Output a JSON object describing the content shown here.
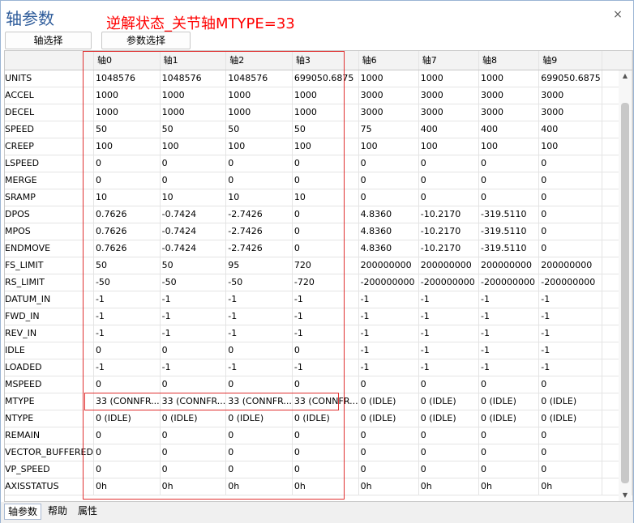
{
  "window": {
    "title": "轴参数",
    "annotation": "逆解状态_关节轴MTYPE=33",
    "close_symbol": "×"
  },
  "toolbar": {
    "axis_select_label": "轴选择",
    "param_select_label": "参数选择"
  },
  "grid": {
    "columns": [
      "",
      "轴0",
      "轴1",
      "轴2",
      "轴3",
      "轴6",
      "轴7",
      "轴8",
      "轴9",
      ""
    ],
    "rows": [
      {
        "name": "UNITS",
        "values": [
          "1048576",
          "1048576",
          "1048576",
          "699050.6875",
          "1000",
          "1000",
          "1000",
          "699050.6875"
        ]
      },
      {
        "name": "ACCEL",
        "values": [
          "1000",
          "1000",
          "1000",
          "1000",
          "3000",
          "3000",
          "3000",
          "3000"
        ]
      },
      {
        "name": "DECEL",
        "values": [
          "1000",
          "1000",
          "1000",
          "1000",
          "3000",
          "3000",
          "3000",
          "3000"
        ]
      },
      {
        "name": "SPEED",
        "values": [
          "50",
          "50",
          "50",
          "50",
          "75",
          "400",
          "400",
          "400"
        ]
      },
      {
        "name": "CREEP",
        "values": [
          "100",
          "100",
          "100",
          "100",
          "100",
          "100",
          "100",
          "100"
        ]
      },
      {
        "name": "LSPEED",
        "values": [
          "0",
          "0",
          "0",
          "0",
          "0",
          "0",
          "0",
          "0"
        ]
      },
      {
        "name": "MERGE",
        "values": [
          "0",
          "0",
          "0",
          "0",
          "0",
          "0",
          "0",
          "0"
        ]
      },
      {
        "name": "SRAMP",
        "values": [
          "10",
          "10",
          "10",
          "10",
          "0",
          "0",
          "0",
          "0"
        ]
      },
      {
        "name": "DPOS",
        "values": [
          "0.7626",
          "-0.7424",
          "-2.7426",
          "0",
          "4.8360",
          "-10.2170",
          "-319.5110",
          "0"
        ]
      },
      {
        "name": "MPOS",
        "values": [
          "0.7626",
          "-0.7424",
          "-2.7426",
          "0",
          "4.8360",
          "-10.2170",
          "-319.5110",
          "0"
        ]
      },
      {
        "name": "ENDMOVE",
        "values": [
          "0.7626",
          "-0.7424",
          "-2.7426",
          "0",
          "4.8360",
          "-10.2170",
          "-319.5110",
          "0"
        ]
      },
      {
        "name": "FS_LIMIT",
        "values": [
          "50",
          "50",
          "95",
          "720",
          "200000000",
          "200000000",
          "200000000",
          "200000000"
        ]
      },
      {
        "name": "RS_LIMIT",
        "values": [
          "-50",
          "-50",
          "-50",
          "-720",
          "-200000000",
          "-200000000",
          "-200000000",
          "-200000000"
        ]
      },
      {
        "name": "DATUM_IN",
        "values": [
          "-1",
          "-1",
          "-1",
          "-1",
          "-1",
          "-1",
          "-1",
          "-1"
        ]
      },
      {
        "name": "FWD_IN",
        "values": [
          "-1",
          "-1",
          "-1",
          "-1",
          "-1",
          "-1",
          "-1",
          "-1"
        ]
      },
      {
        "name": "REV_IN",
        "values": [
          "-1",
          "-1",
          "-1",
          "-1",
          "-1",
          "-1",
          "-1",
          "-1"
        ]
      },
      {
        "name": "IDLE",
        "values": [
          "0",
          "0",
          "0",
          "0",
          "-1",
          "-1",
          "-1",
          "-1"
        ]
      },
      {
        "name": "LOADED",
        "values": [
          "-1",
          "-1",
          "-1",
          "-1",
          "-1",
          "-1",
          "-1",
          "-1"
        ]
      },
      {
        "name": "MSPEED",
        "values": [
          "0",
          "0",
          "0",
          "0",
          "0",
          "0",
          "0",
          "0"
        ]
      },
      {
        "name": "MTYPE",
        "values": [
          "33 (CONNFR...",
          "33 (CONNFR...",
          "33 (CONNFR...",
          "33 (CONNFR...",
          "0 (IDLE)",
          "0 (IDLE)",
          "0 (IDLE)",
          "0 (IDLE)"
        ]
      },
      {
        "name": "NTYPE",
        "values": [
          "0 (IDLE)",
          "0 (IDLE)",
          "0 (IDLE)",
          "0 (IDLE)",
          "0 (IDLE)",
          "0 (IDLE)",
          "0 (IDLE)",
          "0 (IDLE)"
        ]
      },
      {
        "name": "REMAIN",
        "values": [
          "0",
          "0",
          "0",
          "0",
          "0",
          "0",
          "0",
          "0"
        ]
      },
      {
        "name": "VECTOR_BUFFERED",
        "values": [
          "0",
          "0",
          "0",
          "0",
          "0",
          "0",
          "0",
          "0"
        ]
      },
      {
        "name": "VP_SPEED",
        "values": [
          "0",
          "0",
          "0",
          "0",
          "0",
          "0",
          "0",
          "0"
        ]
      },
      {
        "name": "AXISSTATUS",
        "values": [
          "0h",
          "0h",
          "0h",
          "0h",
          "0h",
          "0h",
          "0h",
          "0h"
        ]
      }
    ]
  },
  "scrollbar": {
    "up_symbol": "▲",
    "down_symbol": "▼"
  },
  "bottom_tabs": [
    "轴参数",
    "帮助",
    "属性"
  ],
  "colors": {
    "title": "#2d5b9a",
    "annotation": "#ff0000",
    "highlight": "#e03030"
  }
}
